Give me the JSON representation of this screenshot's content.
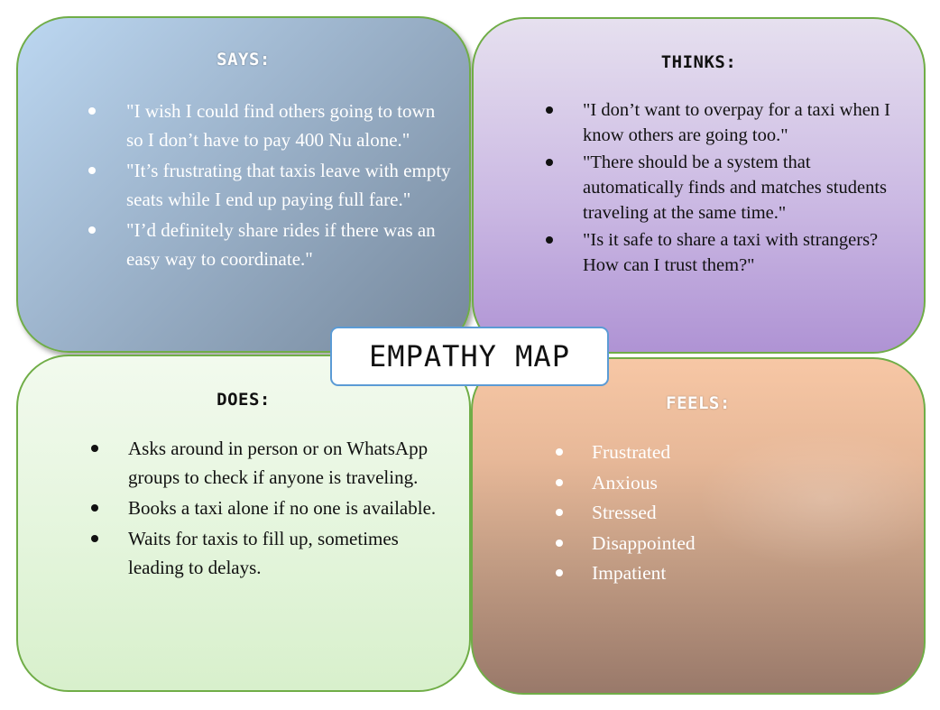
{
  "title": "EMPATHY MAP",
  "says": {
    "heading": "SAYS:",
    "items": [
      "\"I wish I could find others going to town so I don’t have to pay 400 Nu alone.\"",
      "\"It’s frustrating that taxis leave with empty seats while I end up paying full fare.\"",
      "\"I’d definitely share rides if there was an easy way to coordinate.\""
    ]
  },
  "thinks": {
    "heading": "THINKS:",
    "items": [
      "\"I don’t want to overpay for a taxi when I know others are going too.\"",
      "\"There should be a system that automatically finds and matches students traveling at the same time.\"",
      "\"Is it safe to share a taxi with strangers? How can I trust them?\""
    ]
  },
  "does": {
    "heading": "DOES:",
    "items": [
      "Asks around in person or on WhatsApp groups to check if anyone is traveling.",
      "Books a taxi alone if no one is available.",
      "Waits for taxis to fill up, sometimes leading to delays."
    ]
  },
  "feels": {
    "heading": "FEELS:",
    "items": [
      "Frustrated",
      "Anxious",
      "Stressed",
      "Disappointed",
      "Impatient"
    ]
  },
  "colors": {
    "quadrant_border": "#70ad47",
    "title_border": "#5b9bd5",
    "says_fill": "#9cb3cb",
    "thinks_fill": "#cbb9e3",
    "does_fill": "#e4f5dc",
    "feels_fill": "#c39d84"
  }
}
